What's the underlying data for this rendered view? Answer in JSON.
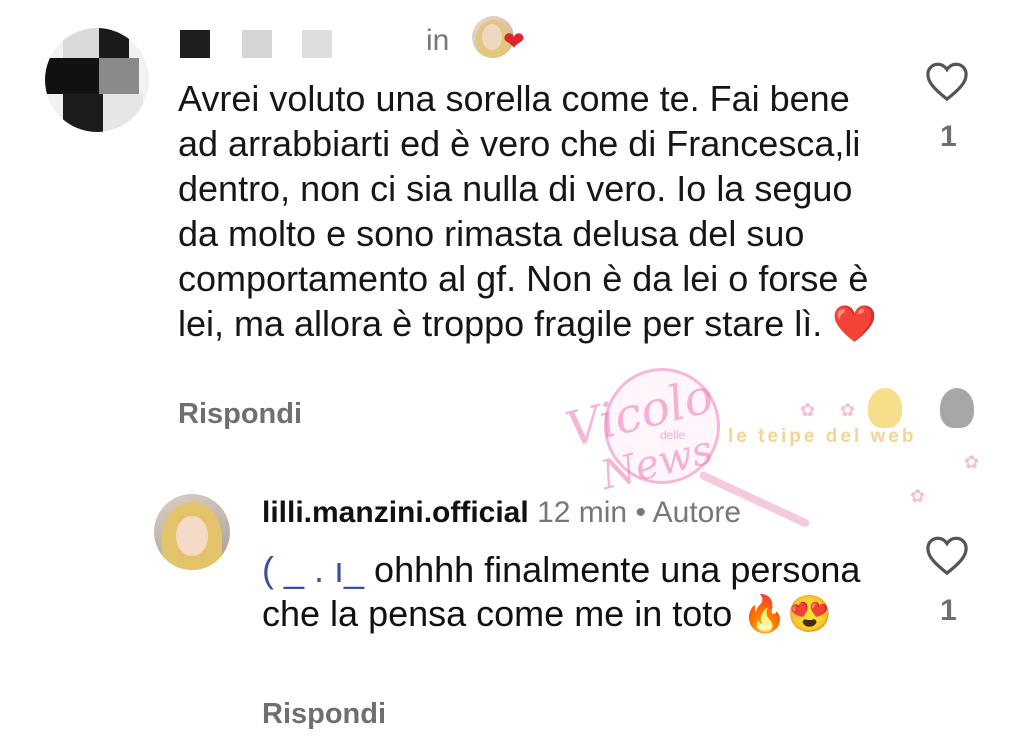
{
  "comment": {
    "time_fragment": "in",
    "text": "Avrei voluto una sorella come te. Fai bene ad arrabbiarti ed è vero che di Francesca,li dentro, non ci sia nulla di vero. Io la seguo da molto e sono rimasta delusa del suo comportamento al gf. Non è da lei o forse è lei, ma allora è troppo fragile per stare lì. ❤️",
    "reply_label": "Rispondi",
    "like_count": "1",
    "liked_by_author_badge": "❤"
  },
  "reply": {
    "username": "lilli.manzini.official",
    "time": "12 min",
    "separator": "•",
    "role": "Autore",
    "mention_redacted": "( _ .            ı_",
    "text": " ohhhh finalmente una persona che la pensa come me in toto 🔥😍",
    "reply_label": "Rispondi",
    "like_count": "1"
  },
  "watermark": {
    "title": "Vicolo",
    "subtitle": "delle",
    "title2": "News",
    "brand": "le teipe del web"
  },
  "colors": {
    "text": "#161616",
    "muted": "#6f6f6f",
    "heart": "#e0242c",
    "watermark_pink": "#ec78b4"
  },
  "icons": {
    "like": "heart-outline-icon"
  }
}
